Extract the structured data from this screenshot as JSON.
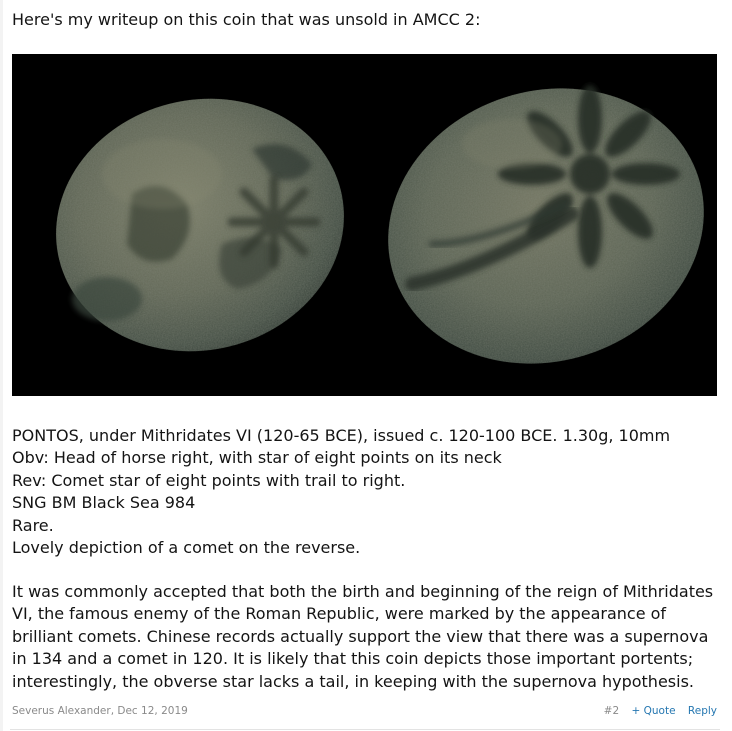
{
  "post": {
    "intro": "Here's my writeup on this coin that was unsold in AMCC 2:",
    "image_alt": "Obverse and reverse of a Pontos bronze coin: horse head with star, and comet with trail",
    "spec_lines": [
      "PONTOS, under Mithridates VI (120-65 BCE), issued c. 120-100 BCE. 1.30g, 10mm",
      "Obv: Head of horse right, with star of eight points on its neck",
      "Rev: Comet star of eight points with trail to right.",
      "SNG BM Black Sea 984",
      "Rare.",
      "Lovely depiction of a comet on the reverse."
    ],
    "body": "It was commonly accepted that both the birth and beginning of the reign of Mithridates VI, the famous enemy of the Roman Republic, were marked by the appearance of brilliant comets. Chinese records actually support the view that there was a supernova in 134 and a comet in 120. It is likely that this coin depicts those important portents; interestingly, the obverse star lacks a tail, in keeping with the supernova hypothesis."
  },
  "meta": {
    "author": "Severus Alexander",
    "separator": ", ",
    "date": "Dec 12, 2019"
  },
  "actions": {
    "post_number": "#2",
    "quote_label": "+ Quote",
    "reply_label": "Reply"
  },
  "colors": {
    "link": "#2577b1",
    "muted": "#8a8a8a",
    "image_bg": "#000000"
  }
}
